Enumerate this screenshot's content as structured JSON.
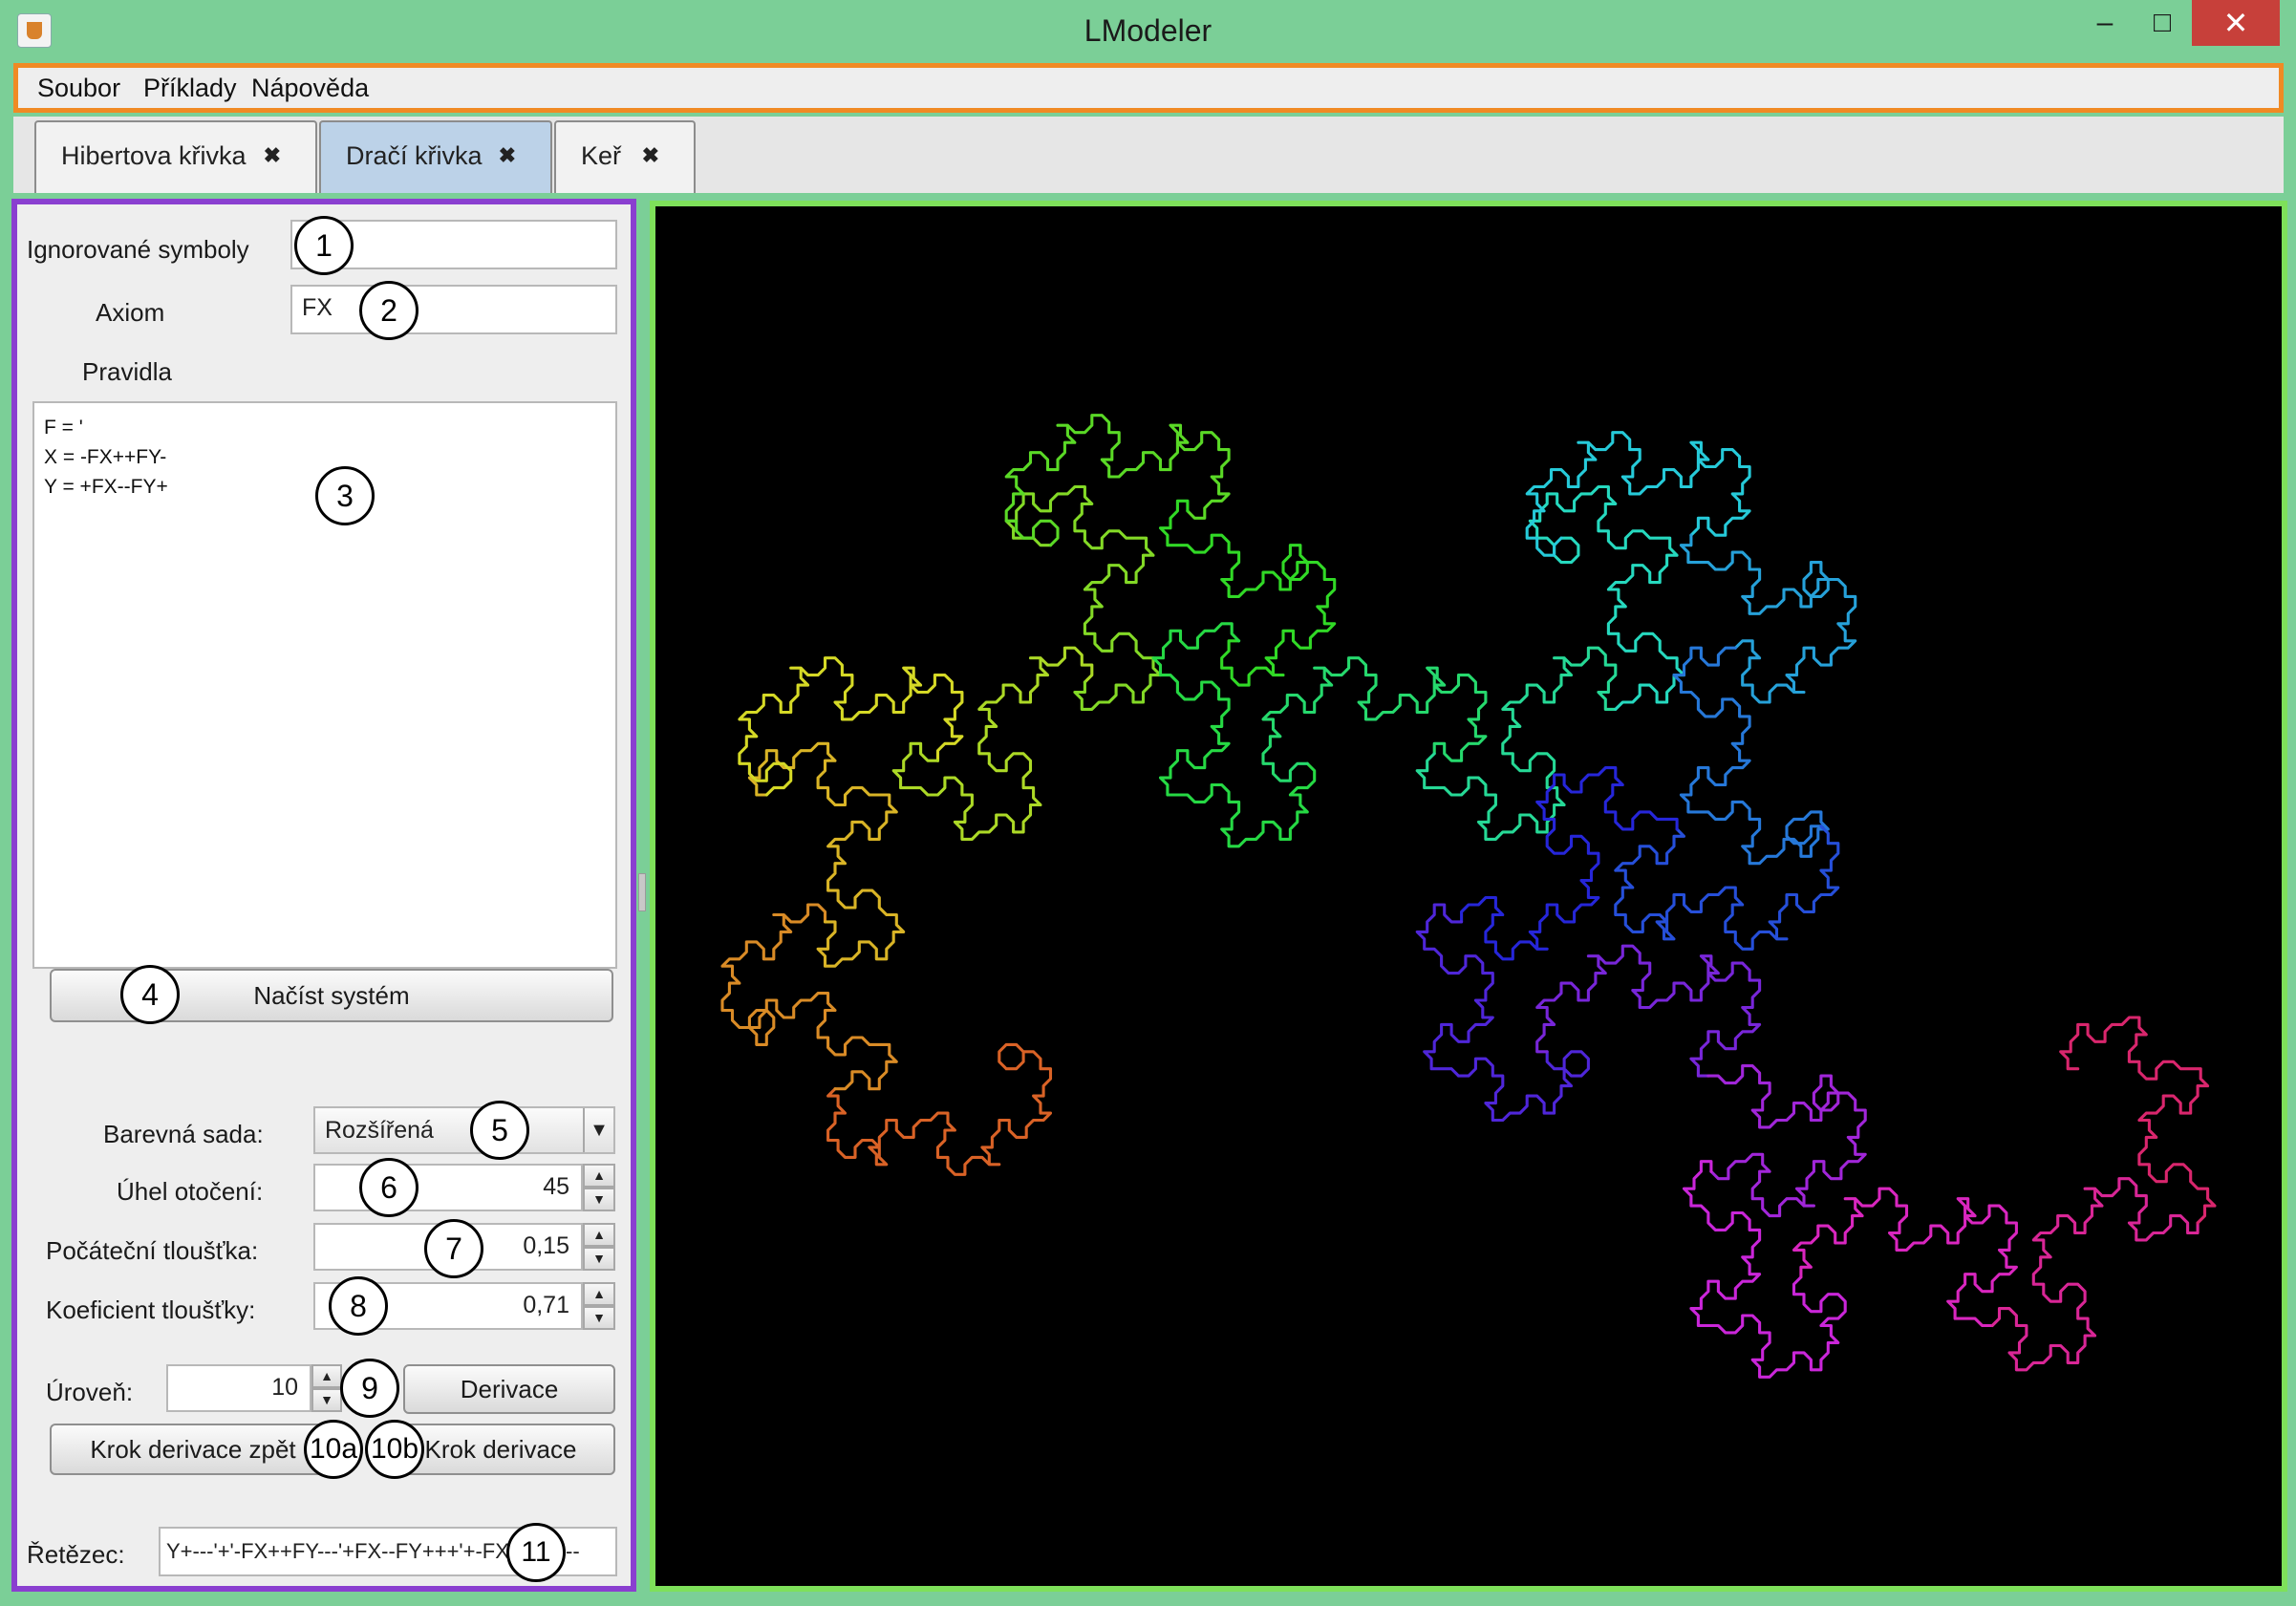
{
  "window": {
    "title": "LModeler",
    "min": "–",
    "max": "□",
    "close": "✕",
    "icon": "java-cup-icon"
  },
  "menu": [
    "Soubor",
    "Příklady",
    "Nápověda"
  ],
  "tabs": [
    {
      "label": "Hibertova křivka",
      "close": "✖"
    },
    {
      "label": "Dračí křivka",
      "close": "✖"
    },
    {
      "label": "Keř",
      "close": "✖"
    }
  ],
  "form": {
    "ignored_label": "Ignorované symboly",
    "ignored_value": "",
    "axiom_label": "Axiom",
    "axiom_value": "FX",
    "rules_label": "Pravidla",
    "rules": [
      "F = '",
      "X = -FX++FY-",
      "Y = +FX--FY+"
    ],
    "load_button": "Načíst systém",
    "color_set_label": "Barevná sada:",
    "color_set_value": "Rozšířená",
    "angle_label": "Úhel otočení:",
    "angle_value": "45",
    "start_thickness_label": "Počáteční tloušťka:",
    "start_thickness_value": "0,15",
    "thickness_coef_label": "Koeficient tloušťky:",
    "thickness_coef_value": "0,71",
    "level_label": "Úroveň:",
    "level_value": "10",
    "derive_button": "Derivace",
    "step_back_button": "Krok derivace zpět",
    "step_button": "Krok derivace",
    "string_label": "Řetězec:",
    "string_value": "Y+---'+'-FX++FY---'+FX--FY+++'+-FX++FY---"
  },
  "callouts": [
    "1",
    "2",
    "3",
    "4",
    "5",
    "6",
    "7",
    "8",
    "9",
    "10a",
    "10b",
    "11"
  ],
  "icons": {
    "spin_up": "▲",
    "spin_down": "▼",
    "dropdown": "▼"
  },
  "colors": {
    "menu_highlight": "#f08a24",
    "panel_highlight": "#8a3fd0",
    "canvas_highlight": "#7ee05a",
    "canvas_bg": "#000000"
  }
}
